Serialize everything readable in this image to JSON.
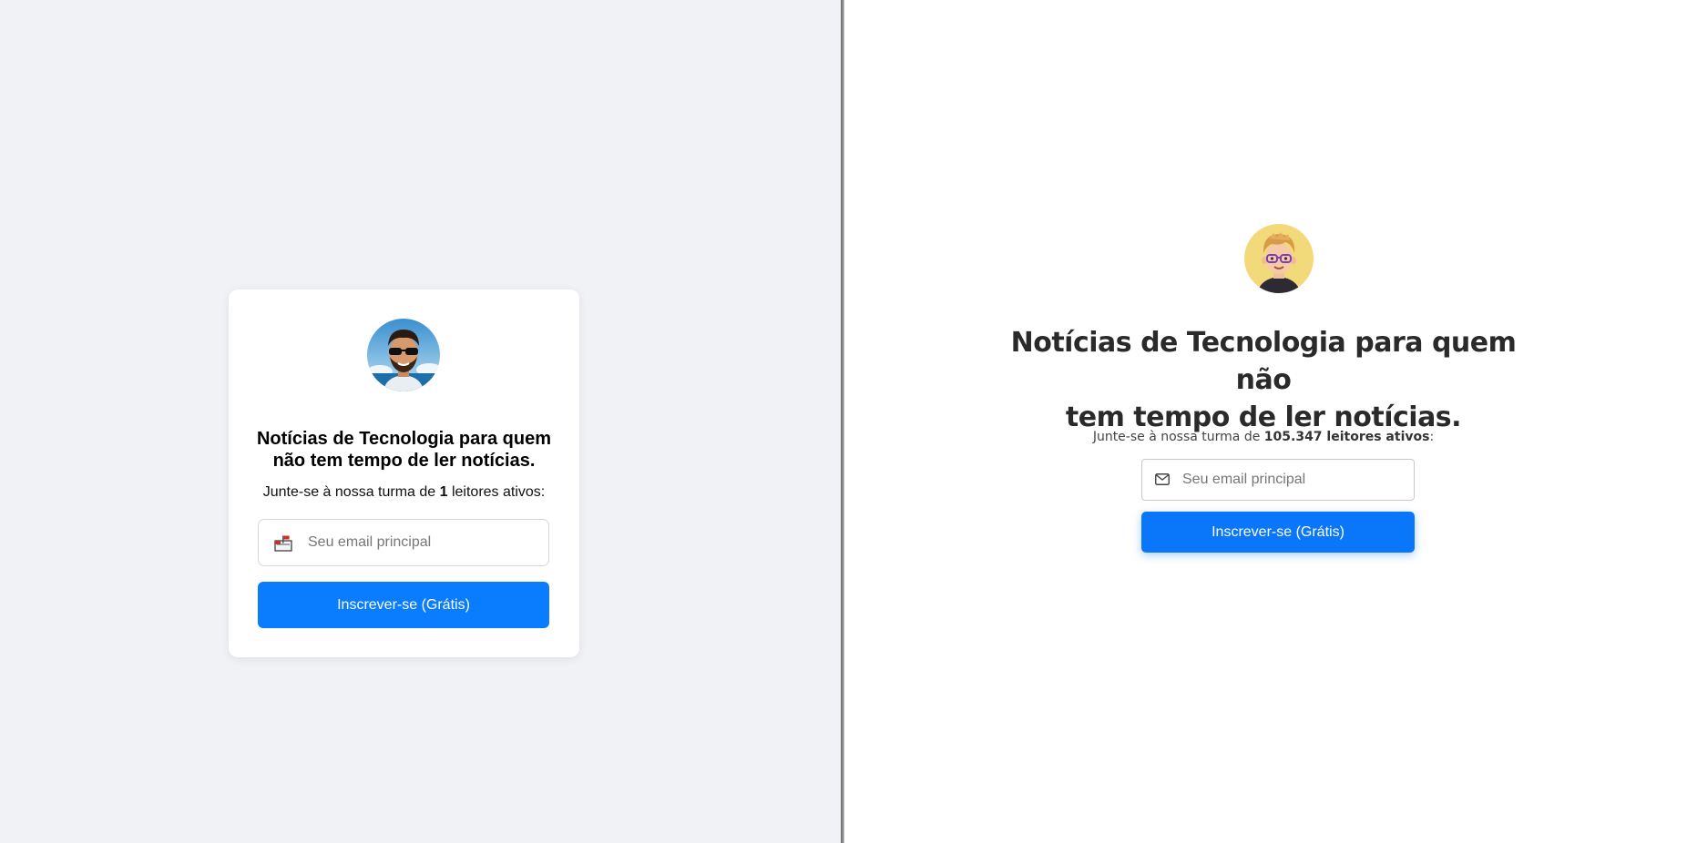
{
  "left": {
    "title": "Notícias de Tecnologia para quem não tem tempo de ler notícias.",
    "subtitle_prefix": "Junte-se à nossa turma de ",
    "reader_count": "1",
    "subtitle_suffix": " leitores ativos:",
    "email_placeholder": "Seu email principal",
    "email_icon": "mailbox-icon",
    "subscribe_label": "Inscrever-se (Grátis)",
    "avatar": "man-with-sunglasses-avatar"
  },
  "right": {
    "title_line1": "Notícias de Tecnologia para quem não",
    "title_line2": "tem tempo de ler notícias.",
    "subtitle_prefix": "Junte-se à nossa turma de ",
    "reader_count": "105.347 leitores ativos",
    "subtitle_suffix": ":",
    "email_placeholder": "Seu email principal",
    "email_icon": "envelope-icon",
    "subscribe_label": "Inscrever-se (Grátis)",
    "avatar": "cartoon-boy-with-glasses-avatar"
  },
  "colors": {
    "left_background": "#f0f2f5",
    "right_background": "#ffffff",
    "button_blue": "#0a7cfe",
    "divider": "#8a8a8a"
  }
}
